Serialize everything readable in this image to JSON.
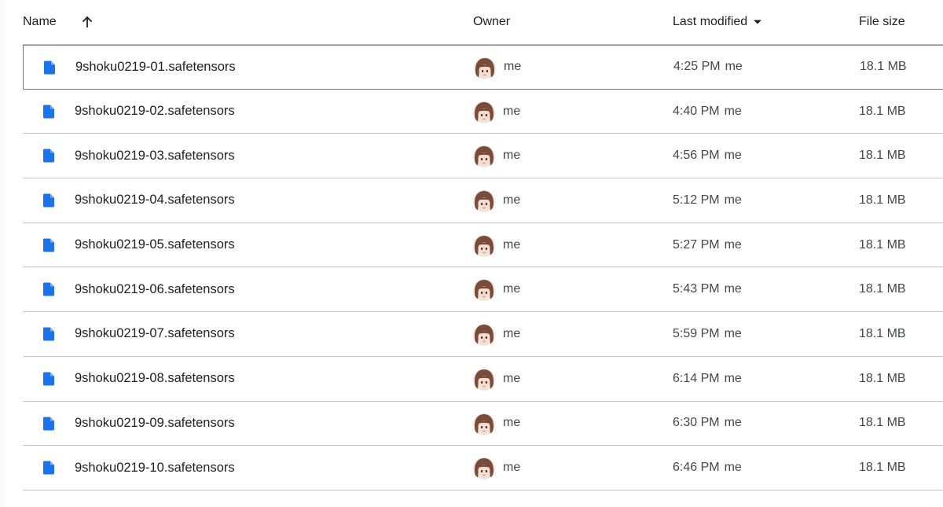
{
  "header": {
    "name_label": "Name",
    "owner_label": "Owner",
    "modified_label": "Last modified",
    "size_label": "File size",
    "sort_icon": "arrow-upward-icon",
    "modified_sort_icon": "caret-down-icon"
  },
  "colors": {
    "file_icon": "#1a73e8",
    "selection_border": "#4a7cc3",
    "divider": "#c7c7c7",
    "avatar_hair": "#7a4a3a",
    "avatar_face": "#f6ddd0"
  },
  "files": [
    {
      "name": "9shoku0219-01.safetensors",
      "owner": "me",
      "time": "4:25 PM",
      "modified_by": "me",
      "size": "18.1 MB",
      "selected": true
    },
    {
      "name": "9shoku0219-02.safetensors",
      "owner": "me",
      "time": "4:40 PM",
      "modified_by": "me",
      "size": "18.1 MB"
    },
    {
      "name": "9shoku0219-03.safetensors",
      "owner": "me",
      "time": "4:56 PM",
      "modified_by": "me",
      "size": "18.1 MB"
    },
    {
      "name": "9shoku0219-04.safetensors",
      "owner": "me",
      "time": "5:12 PM",
      "modified_by": "me",
      "size": "18.1 MB"
    },
    {
      "name": "9shoku0219-05.safetensors",
      "owner": "me",
      "time": "5:27 PM",
      "modified_by": "me",
      "size": "18.1 MB"
    },
    {
      "name": "9shoku0219-06.safetensors",
      "owner": "me",
      "time": "5:43 PM",
      "modified_by": "me",
      "size": "18.1 MB"
    },
    {
      "name": "9shoku0219-07.safetensors",
      "owner": "me",
      "time": "5:59 PM",
      "modified_by": "me",
      "size": "18.1 MB"
    },
    {
      "name": "9shoku0219-08.safetensors",
      "owner": "me",
      "time": "6:14 PM",
      "modified_by": "me",
      "size": "18.1 MB"
    },
    {
      "name": "9shoku0219-09.safetensors",
      "owner": "me",
      "time": "6:30 PM",
      "modified_by": "me",
      "size": "18.1 MB"
    },
    {
      "name": "9shoku0219-10.safetensors",
      "owner": "me",
      "time": "6:46 PM",
      "modified_by": "me",
      "size": "18.1 MB"
    }
  ]
}
